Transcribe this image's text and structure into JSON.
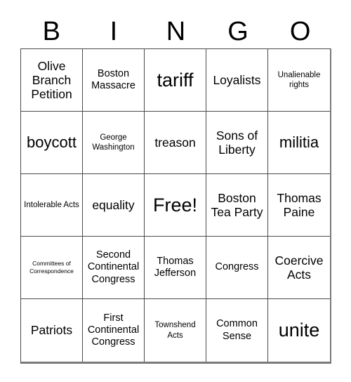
{
  "card": {
    "title_letters": [
      "B",
      "I",
      "N",
      "G",
      "O"
    ],
    "rows": [
      [
        {
          "text": "Olive Branch Petition",
          "size": "fs-lg"
        },
        {
          "text": "Boston Massacre",
          "size": "fs-md"
        },
        {
          "text": "tariff",
          "size": "fs-xxl"
        },
        {
          "text": "Loyalists",
          "size": "fs-lg"
        },
        {
          "text": "Unalienable rights",
          "size": "fs-sm"
        }
      ],
      [
        {
          "text": "boycott",
          "size": "fs-xl"
        },
        {
          "text": "George Washington",
          "size": "fs-sm"
        },
        {
          "text": "treason",
          "size": "fs-lg"
        },
        {
          "text": "Sons of Liberty",
          "size": "fs-lg"
        },
        {
          "text": "militia",
          "size": "fs-xl"
        }
      ],
      [
        {
          "text": "Intolerable Acts",
          "size": "fs-sm"
        },
        {
          "text": "equality",
          "size": "fs-lg"
        },
        {
          "text": "Free!",
          "size": "fs-xxl"
        },
        {
          "text": "Boston Tea Party",
          "size": "fs-lg"
        },
        {
          "text": "Thomas Paine",
          "size": "fs-lg"
        }
      ],
      [
        {
          "text": "Committees of Correspondence",
          "size": "fs-xs"
        },
        {
          "text": "Second Continental Congress",
          "size": "fs-md"
        },
        {
          "text": "Thomas Jefferson",
          "size": "fs-md"
        },
        {
          "text": "Congress",
          "size": "fs-md"
        },
        {
          "text": "Coercive Acts",
          "size": "fs-lg"
        }
      ],
      [
        {
          "text": "Patriots",
          "size": "fs-lg"
        },
        {
          "text": "First Continental Congress",
          "size": "fs-md"
        },
        {
          "text": "Townshend Acts",
          "size": "fs-sm"
        },
        {
          "text": "Common Sense",
          "size": "fs-md"
        },
        {
          "text": "unite",
          "size": "fs-xxl"
        }
      ]
    ]
  },
  "colors": {
    "background": "#ffffff",
    "text": "#000000",
    "grid_line": "#4a4a4a",
    "grid_shadow": "#7a7a7a"
  }
}
